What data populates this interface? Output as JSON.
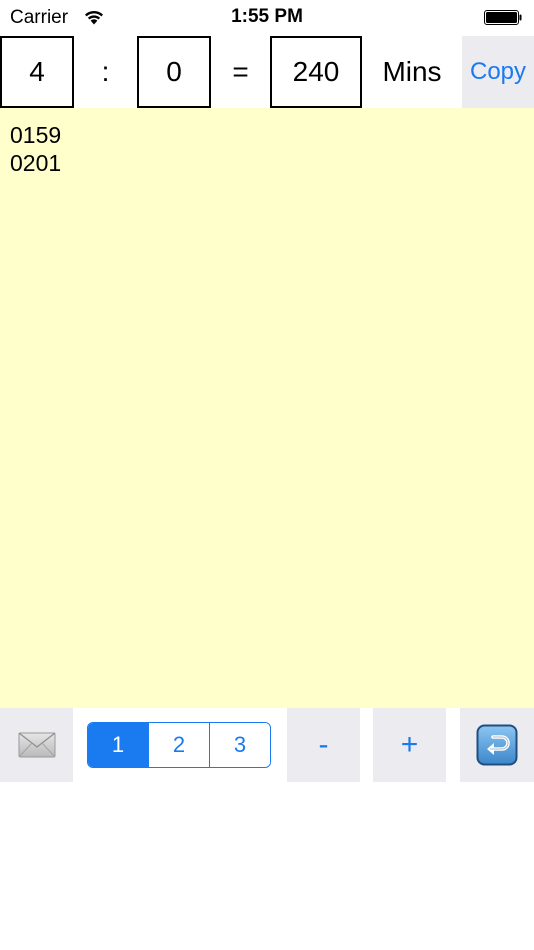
{
  "status_bar": {
    "carrier": "Carrier",
    "time": "1:55 PM"
  },
  "converter": {
    "hours": "4",
    "separator": ":",
    "minutes": "0",
    "equals": "=",
    "total": "240",
    "unit": "Mins",
    "copy_label": "Copy"
  },
  "notes": {
    "lines": [
      "0159",
      "0201"
    ]
  },
  "toolbar": {
    "segments": [
      "1",
      "2",
      "3"
    ],
    "selected_segment": "1",
    "minus_label": "-",
    "plus_label": "+"
  },
  "colors": {
    "accent": "#1a7af0",
    "notes_background": "#ffffcc",
    "button_background": "#ebebf0"
  },
  "icons": {
    "mail": "envelope-icon",
    "return": "return-arrow-icon",
    "wifi": "wifi-icon",
    "battery": "battery-icon"
  }
}
